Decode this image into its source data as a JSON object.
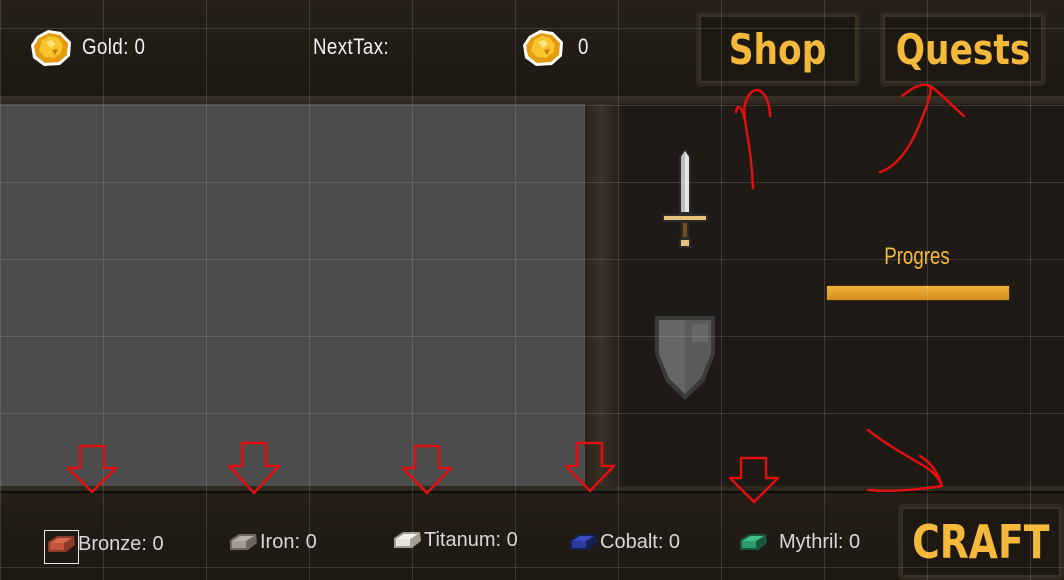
{
  "hud": {
    "gold_label": "Gold: 0",
    "next_tax_label": "NextTax:",
    "next_tax_value": "0",
    "coin_icon": "gold-nugget-icon"
  },
  "buttons": {
    "shop": "Shop",
    "quests": "Quests",
    "craft": "CRAFT"
  },
  "craft": {
    "items": [
      "sword-icon",
      "shield-icon"
    ],
    "progress_label": "Progres",
    "progress_value": 1.0
  },
  "resources": [
    {
      "label": "Bronze: 0",
      "icon": "bronze-ingot-icon",
      "color": "#c4543a"
    },
    {
      "label": "Iron: 0",
      "icon": "iron-ingot-icon",
      "color": "#a49a94"
    },
    {
      "label": "Titanum: 0",
      "icon": "titanium-ingot-icon",
      "color": "#e8e2dc"
    },
    {
      "label": "Cobalt: 0",
      "icon": "cobalt-ingot-icon",
      "color": "#2b3a9e"
    },
    {
      "label": "Mythril: 0",
      "icon": "mythril-ingot-icon",
      "color": "#2f9a6e"
    }
  ],
  "colors": {
    "accent": "#f4b93a",
    "annotation": "#e01010",
    "play_area": "#4c4c4c"
  }
}
